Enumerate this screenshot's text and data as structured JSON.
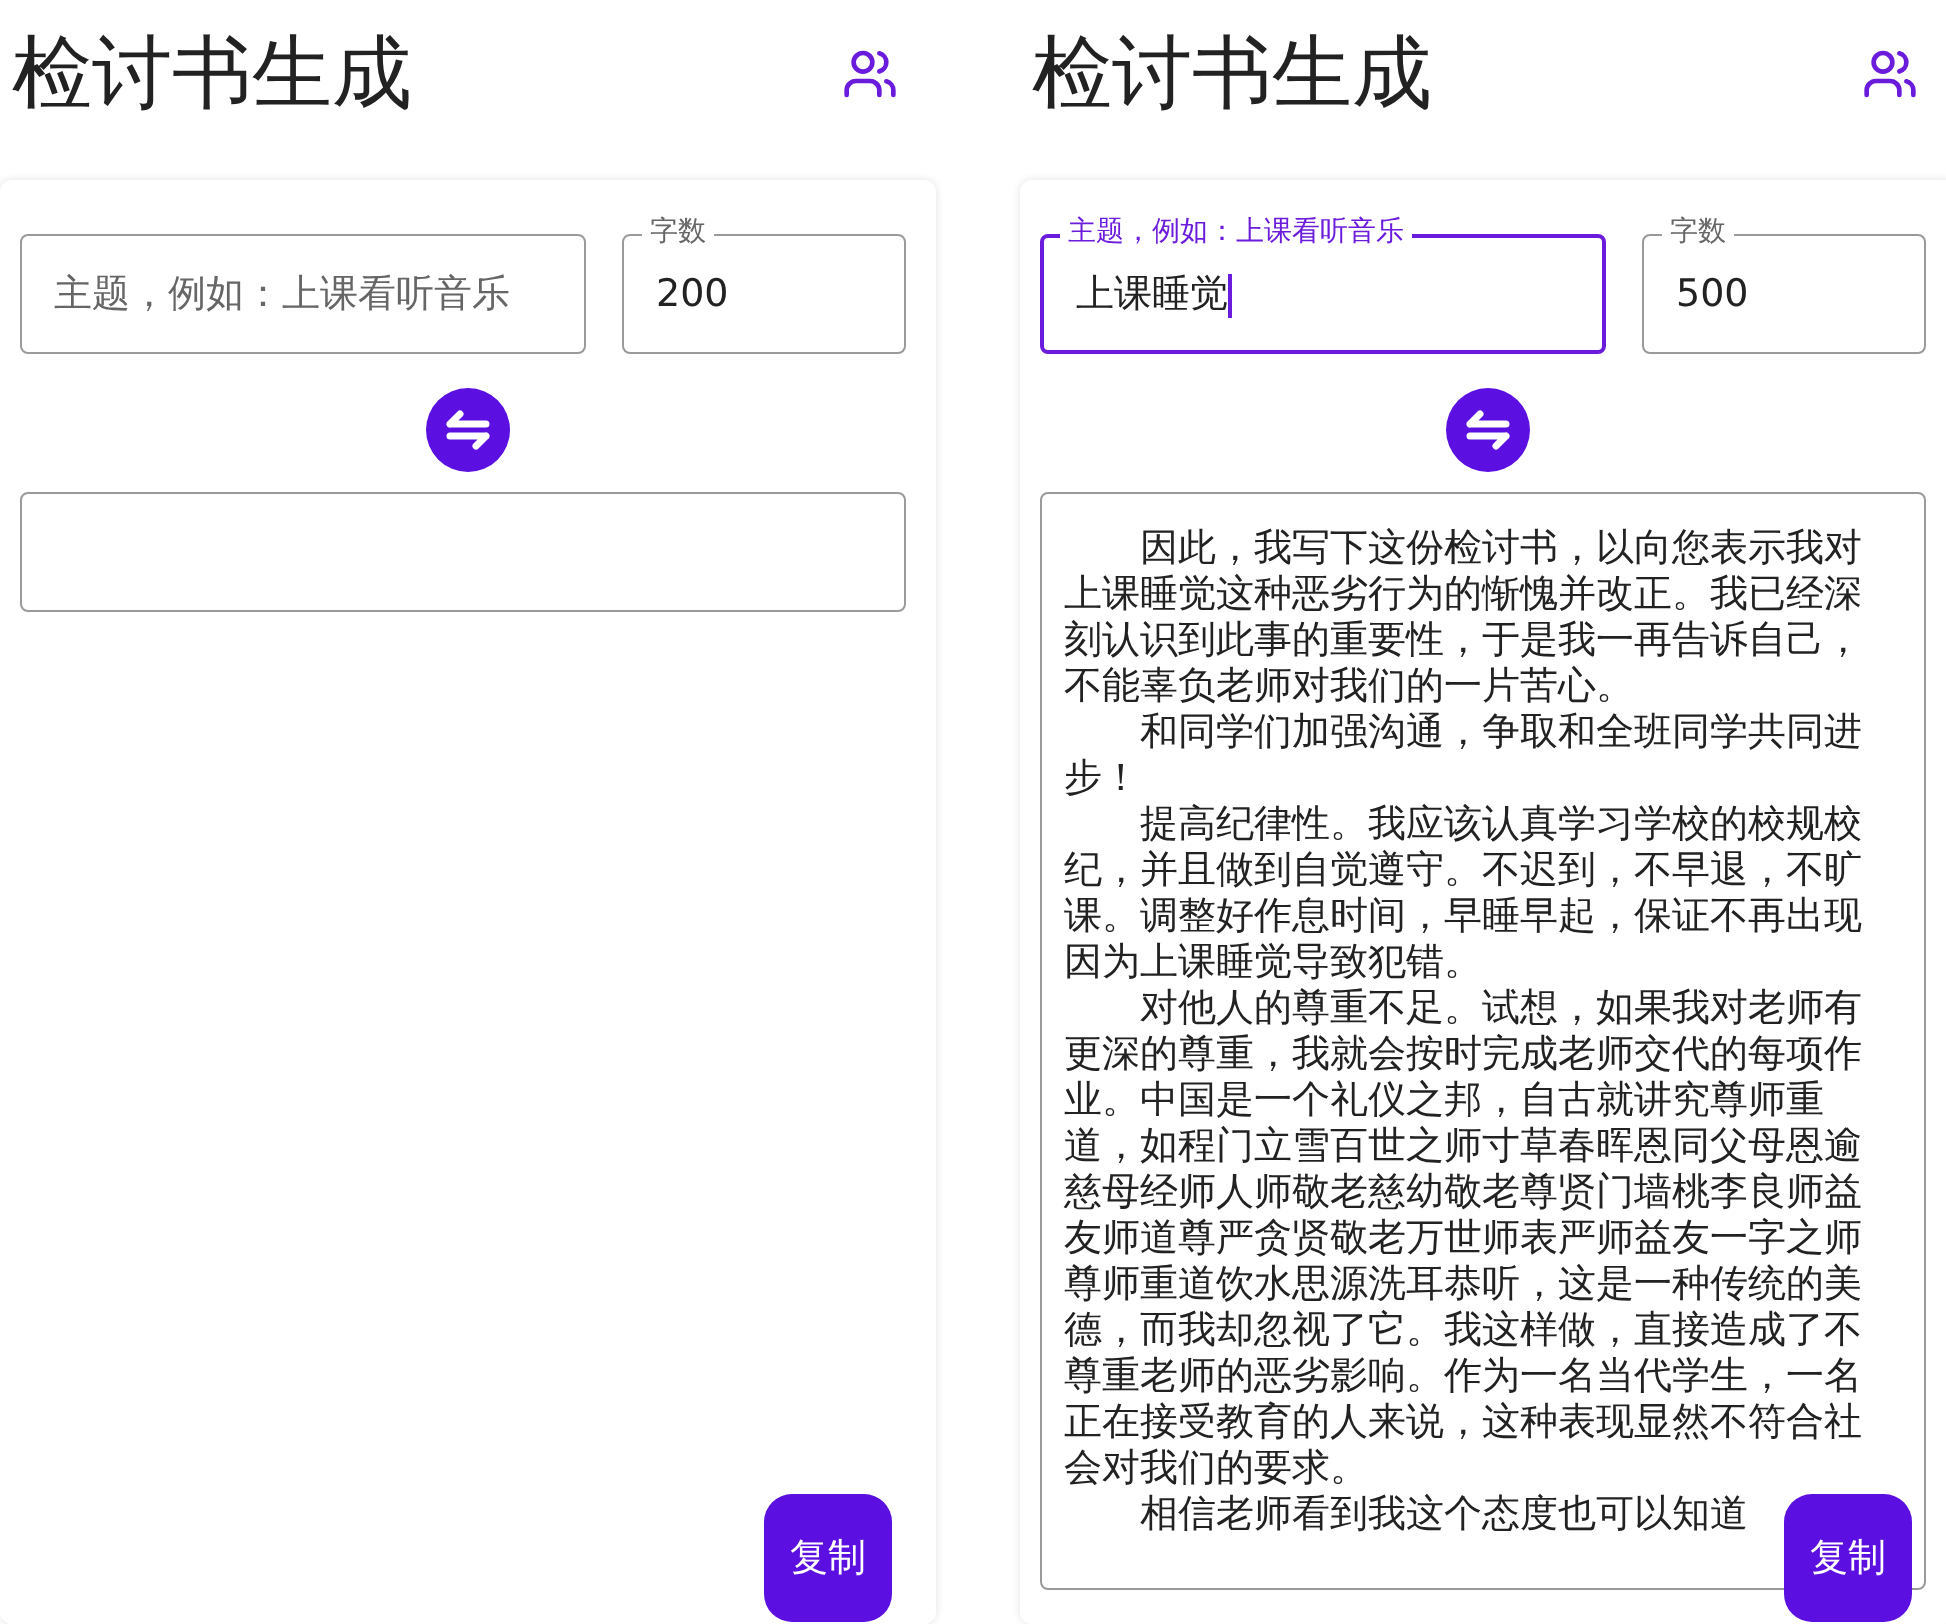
{
  "screens": [
    {
      "title": "检讨书生成",
      "topic_field": {
        "placeholder": "主题，例如：上课看听音乐",
        "focused": false
      },
      "count_field": {
        "label": "字数",
        "value": "200"
      },
      "copy_button": "复制"
    },
    {
      "title": "检讨书生成",
      "topic_field": {
        "label": "主题，例如：上课看听音乐",
        "value": "上课睡觉",
        "focused": true
      },
      "count_field": {
        "label": "字数",
        "value": "500"
      },
      "output": {
        "paragraphs": [
          "因此，我写下这份检讨书，以向您表示我对上课睡觉这种恶劣行为的惭愧并改正。我已经深刻认识到此事的重要性，于是我一再告诉自己，不能辜负老师对我们的一片苦心。",
          "和同学们加强沟通，争取和全班同学共同进步！",
          "提高纪律性。我应该认真学习学校的校规校纪，并且做到自觉遵守。不迟到，不早退，不旷课。调整好作息时间，早睡早起，保证不再出现因为上课睡觉导致犯错。",
          "对他人的尊重不足。试想，如果我对老师有更深的尊重，我就会按时完成老师交代的每项作业。中国是一个礼仪之邦，自古就讲究尊师重道，如程门立雪百世之师寸草春晖恩同父母恩逾慈母经师人师敬老慈幼敬老尊贤门墙桃李良师益友师道尊严贪贤敬老万世师表严师益友一字之师尊师重道饮水思源洗耳恭听，这是一种传统的美德，而我却忽视了它。我这样做，直接造成了不尊重老师的恶劣影响。作为一名当代学生，一名正在接受教育的人来说，这种表现显然不符合社会对我们的要求。",
          "相信老师看到我这个态度也可以知道"
        ]
      },
      "copy_button": "复制"
    }
  ]
}
